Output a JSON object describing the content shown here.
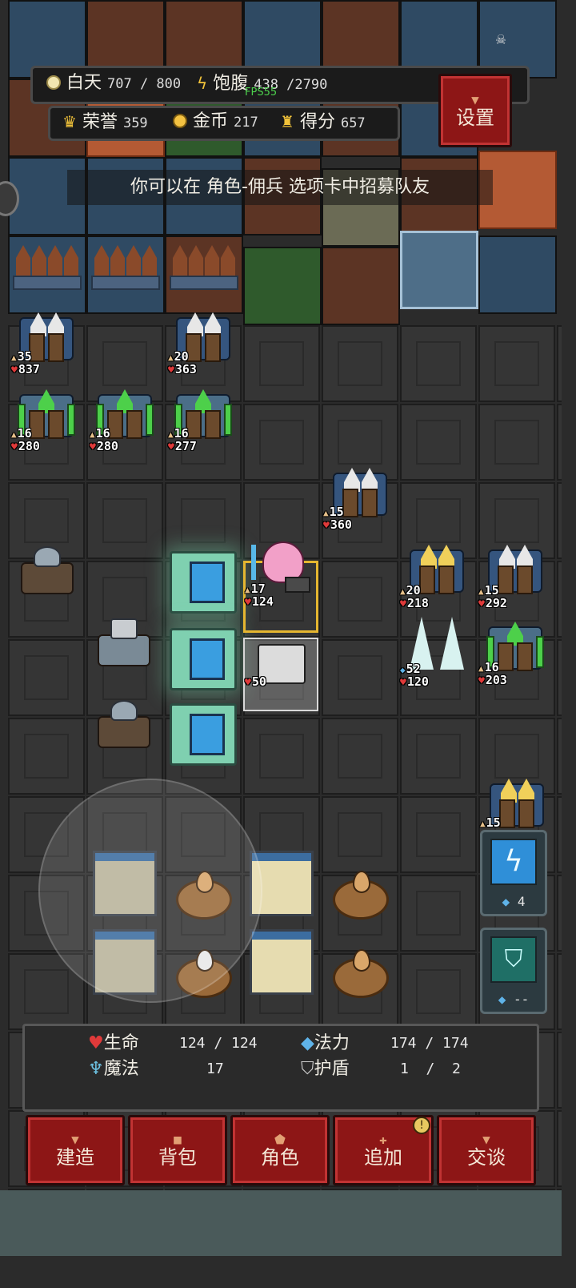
{
  "hud": {
    "day_label": "白天",
    "day_value": "707 / 800",
    "food_label": "饱腹",
    "food_value": "438 /2790",
    "fps_label": "FPS55",
    "honor_label": "荣誉",
    "honor_value": "359",
    "gold_label": "金币",
    "gold_value": "217",
    "score_label": "得分",
    "score_value": "657",
    "settings_label": "设置"
  },
  "hint": "你可以在 角色-佣兵 选项卡中招募队友",
  "units": [
    {
      "lv": "35",
      "hp": "837"
    },
    {
      "lv": "20",
      "hp": "363"
    },
    {
      "lv": "16",
      "hp": "280"
    },
    {
      "lv": "16",
      "hp": "280"
    },
    {
      "lv": "16",
      "hp": "277"
    },
    {
      "lv": "15",
      "hp": "360"
    },
    {
      "lv": "17",
      "hp": "124"
    },
    {
      "hp": "50"
    },
    {
      "lv": "20",
      "hp": "218"
    },
    {
      "lv": "15",
      "hp": "292"
    },
    {
      "mp": "52",
      "hp": "120"
    },
    {
      "lv": "16",
      "hp": "203"
    },
    {
      "lv": "15"
    }
  ],
  "skills": [
    {
      "icon": "lightning-skill-icon",
      "cost": "4"
    },
    {
      "icon": "shield-skill-icon",
      "cost": "--"
    }
  ],
  "player_stats": {
    "life_label": "生命",
    "life_value": "124 / 124",
    "mana_label": "法力",
    "mana_value": "174 / 174",
    "magic_label": "魔法",
    "magic_value": "17",
    "shield_label": "护盾",
    "shield_value": "1  /  2"
  },
  "actions": [
    {
      "label": "建造",
      "icon": "hammer-icon"
    },
    {
      "label": "背包",
      "icon": "backpack-icon"
    },
    {
      "label": "角色",
      "icon": "character-icon"
    },
    {
      "label": "追加",
      "icon": "plus-icon"
    },
    {
      "label": "交谈",
      "icon": "chat-icon"
    }
  ],
  "colors": {
    "accent_red": "#8d1616",
    "health": "#e03a3a",
    "gold": "#f3c242"
  }
}
